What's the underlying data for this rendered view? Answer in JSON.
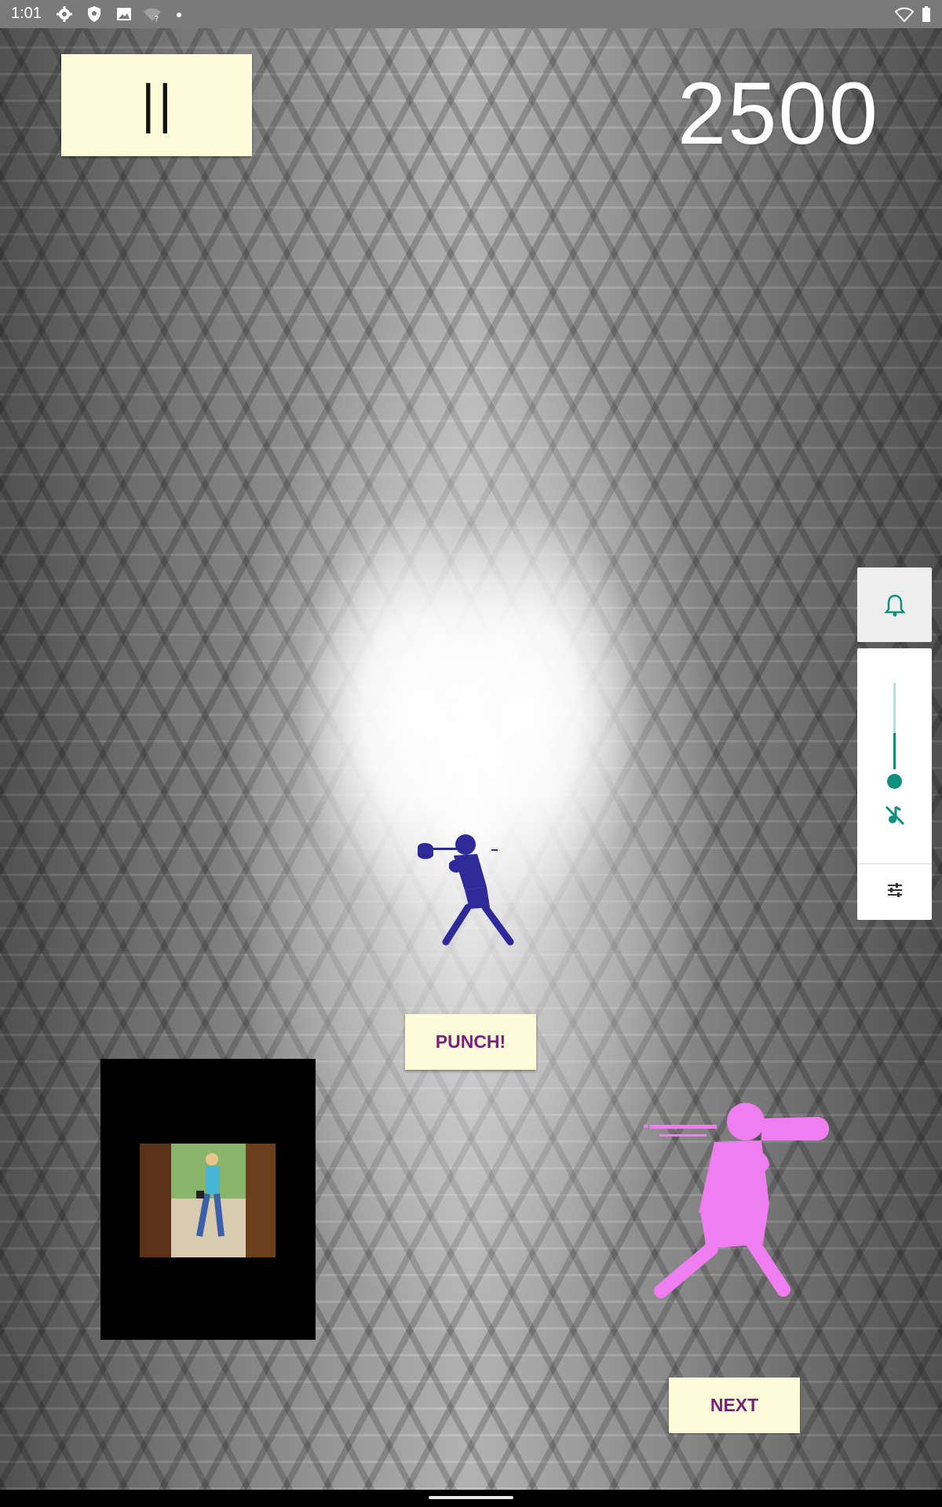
{
  "status_bar": {
    "time": "1:01",
    "icons": [
      "settings-icon",
      "shield-icon",
      "image-icon",
      "wifi-unknown-icon",
      "dot-icon"
    ],
    "right_icons": [
      "wifi-icon",
      "battery-icon"
    ]
  },
  "game": {
    "pause_label": "||",
    "score": "2500",
    "punch_label": "PUNCH!",
    "next_label": "NEXT",
    "opponent_color": "#2f2a9a",
    "player_color": "#f07ef0"
  },
  "volume_panel": {
    "accent": "#0f8f7e",
    "icons": [
      "bell-icon",
      "music-off-icon",
      "sliders-icon"
    ]
  },
  "colors": {
    "button_bg": "#fdfcd8",
    "button_text": "#7b1f7a"
  }
}
